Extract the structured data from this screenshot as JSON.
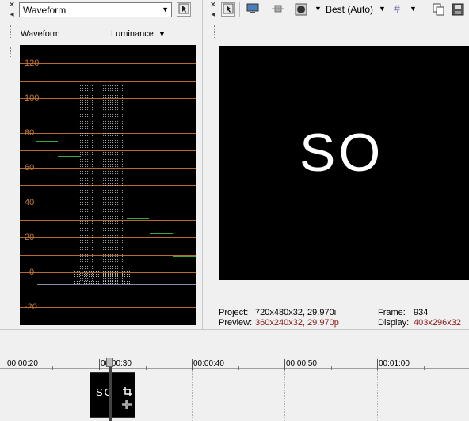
{
  "scopes": {
    "type_select": "Waveform",
    "header_title": "Waveform",
    "mode": "Luminance",
    "y_labels": [
      "120",
      "100",
      "80",
      "60",
      "40",
      "20",
      "0",
      "-20"
    ]
  },
  "preview": {
    "quality": "Best (Auto)",
    "frame_text": "SO",
    "project_label": "Project:",
    "project_value": "720x480x32, 29.970i",
    "preview_label": "Preview:",
    "preview_value": "360x240x32, 29.970p",
    "frame_label": "Frame:",
    "frame_value": "934",
    "display_label": "Display:",
    "display_value": "403x296x32"
  },
  "timeline": {
    "ticks": [
      "00:00:20",
      "00:00:30",
      "00:00:40",
      "00:00:50",
      "00:01:00"
    ],
    "clip_text": "SO"
  },
  "icons": {
    "close": "close-icon",
    "dropdown": "chevron-down-icon",
    "pointer": "pointer-icon",
    "monitor": "monitor-icon",
    "split": "split-screen-icon",
    "overlay": "overlay-icon",
    "grid": "grid-icon",
    "copy": "copy-snapshot-icon",
    "save": "save-snapshot-icon",
    "crop": "crop-icon",
    "move": "pan-icon"
  }
}
